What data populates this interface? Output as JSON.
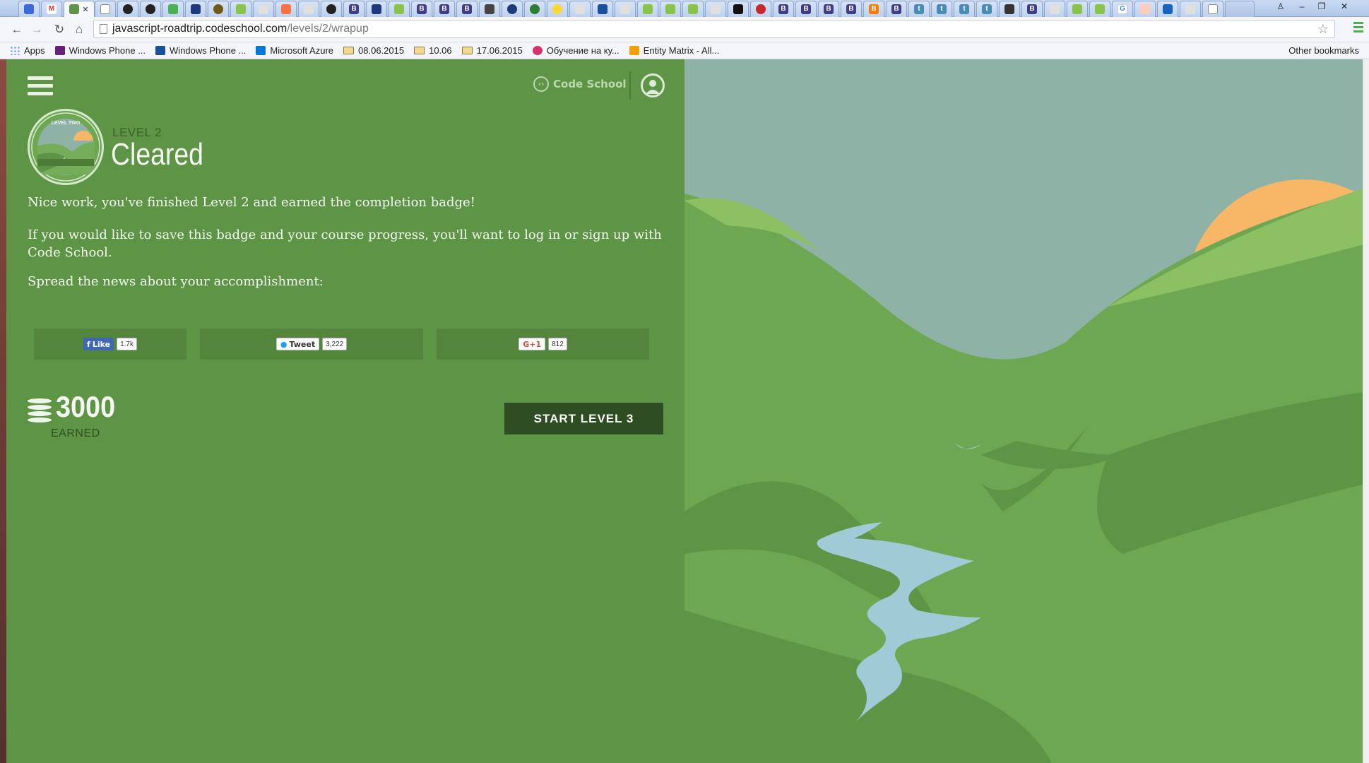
{
  "browser": {
    "url_host": "javascript-roadtrip.codeschool.com",
    "url_path": "/levels/2/wrapup",
    "bookmarks": [
      {
        "label": "Apps",
        "icon": "apps-grid-icon",
        "color": "#4285f4"
      },
      {
        "label": "Windows Phone ...",
        "icon": "windows-phone-icon",
        "color": "#68217a"
      },
      {
        "label": "Windows Phone ...",
        "icon": "ws-icon",
        "color": "#1a4f9c"
      },
      {
        "label": "Microsoft Azure",
        "icon": "windows-logo-icon",
        "color": "#0078d7"
      },
      {
        "label": "08.06.2015",
        "icon": "folder-icon"
      },
      {
        "label": "10.06",
        "icon": "folder-icon"
      },
      {
        "label": "17.06.2015",
        "icon": "folder-icon"
      },
      {
        "label": "Обучение на ку...",
        "icon": "flower-icon",
        "color": "#d6336c"
      },
      {
        "label": "Entity Matrix - All...",
        "icon": "entity-matrix-icon",
        "color": "#f59f00"
      }
    ],
    "other_bookmarks": "Other bookmarks"
  },
  "header": {
    "brand": "Code School"
  },
  "level": {
    "label": "LEVEL 2",
    "status": "Cleared",
    "badge_text": "LEVEL TWO"
  },
  "messages": {
    "congrats": "Nice work, you've finished Level 2 and earned the completion badge!",
    "save_prompt": "If you would like to save this badge and your course progress, you'll want to log in or sign up with Code School.",
    "spread": "Spread the news about your accomplishment:"
  },
  "share": {
    "facebook": {
      "label": "Like",
      "count": "1.7k",
      "color": "#4267b2"
    },
    "twitter": {
      "label": "Tweet",
      "count": "3,222",
      "color": "#1da1f2"
    },
    "google": {
      "label": "G+1",
      "count": "812",
      "color": "#dd4b39"
    }
  },
  "score": {
    "points": "3000",
    "earned_label": "EARNED"
  },
  "actions": {
    "start_next": "START LEVEL 3"
  },
  "colors": {
    "panel": "#5e9446",
    "sky": "#8fb2a7",
    "sun": "#f7b766",
    "river": "#9fcad6",
    "button_dark": "#2e4d22"
  }
}
